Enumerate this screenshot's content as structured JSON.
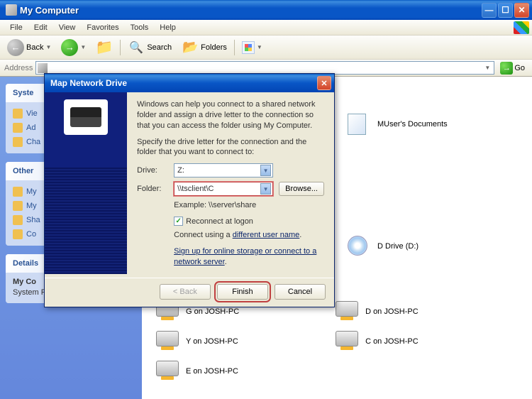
{
  "window": {
    "title": "My Computer"
  },
  "menu": {
    "file": "File",
    "edit": "Edit",
    "view": "View",
    "favorites": "Favorites",
    "tools": "Tools",
    "help": "Help"
  },
  "toolbar": {
    "back": "Back",
    "search": "Search",
    "folders": "Folders"
  },
  "address": {
    "label": "Address",
    "value": "",
    "go": "Go"
  },
  "sidebar": {
    "group1": {
      "title": "Syste",
      "items": [
        "Vie",
        "Ad",
        "Cha"
      ]
    },
    "group2": {
      "title": "Other",
      "items": [
        "My",
        "My",
        "Sha",
        "Co"
      ]
    },
    "group3": {
      "title": "Details",
      "name": "My Co",
      "type": "System Folder"
    }
  },
  "files": {
    "row1": [
      {
        "label": "MUser's Documents",
        "icon": "doc"
      }
    ],
    "row2": [
      {
        "label": "D Drive (D:)",
        "icon": "cd"
      }
    ],
    "row3": [
      {
        "label": "G on JOSH-PC",
        "icon": "netdrive"
      },
      {
        "label": "D on JOSH-PC",
        "icon": "netdrive"
      }
    ],
    "row4": [
      {
        "label": "Y on JOSH-PC",
        "icon": "netdrive"
      },
      {
        "label": "C on JOSH-PC",
        "icon": "netdrive"
      }
    ],
    "row5": [
      {
        "label": "E on JOSH-PC",
        "icon": "netdrive"
      }
    ]
  },
  "dialog": {
    "title": "Map Network Drive",
    "intro": "Windows can help you connect to a shared network folder and assign a drive letter to the connection so that you can access the folder using My Computer.",
    "specify": "Specify the drive letter for the connection and the folder that you want to connect to:",
    "driveLabel": "Drive:",
    "driveValue": "Z:",
    "folderLabel": "Folder:",
    "folderValue": "\\\\tsclient\\C",
    "browse": "Browse...",
    "example": "Example: \\\\server\\share",
    "reconnect": "Reconnect at logon",
    "connectUsing1": "Connect using a ",
    "connectUsing2": "different user name",
    "signup": "Sign up for online storage or connect to a network server",
    "back": "< Back",
    "finish": "Finish",
    "cancel": "Cancel"
  }
}
